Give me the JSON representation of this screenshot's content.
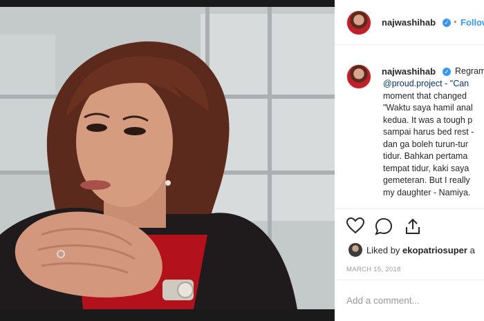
{
  "post": {
    "username": "najwashihab",
    "follow_label": "Follow",
    "regram_label": "Regram",
    "caption_lines": [
      "@proud.project - \"Can",
      "moment that changed",
      "\"Waktu saya hamil anal",
      "kedua. It was a tough p",
      "sampai harus bed rest -",
      "dan ga boleh turun-tur",
      "tidur. Bahkan pertama",
      "tempat tidur, kaki saya",
      "gemeteran. But I really",
      "my daughter - Namiya."
    ],
    "mention": "@proud.project",
    "liked_prefix": "Liked by ",
    "liked_user": "ekopatriosuper",
    "liked_suffix": " a",
    "date": "MARCH 15, 2018",
    "comment_placeholder": "Add a comment..."
  },
  "icons": [
    "heart-icon",
    "comment-icon",
    "share-icon",
    "verified-badge-icon"
  ],
  "colors": {
    "accent": "#3897f0",
    "text": "#262626",
    "muted": "#999999",
    "divider": "#efefef"
  }
}
